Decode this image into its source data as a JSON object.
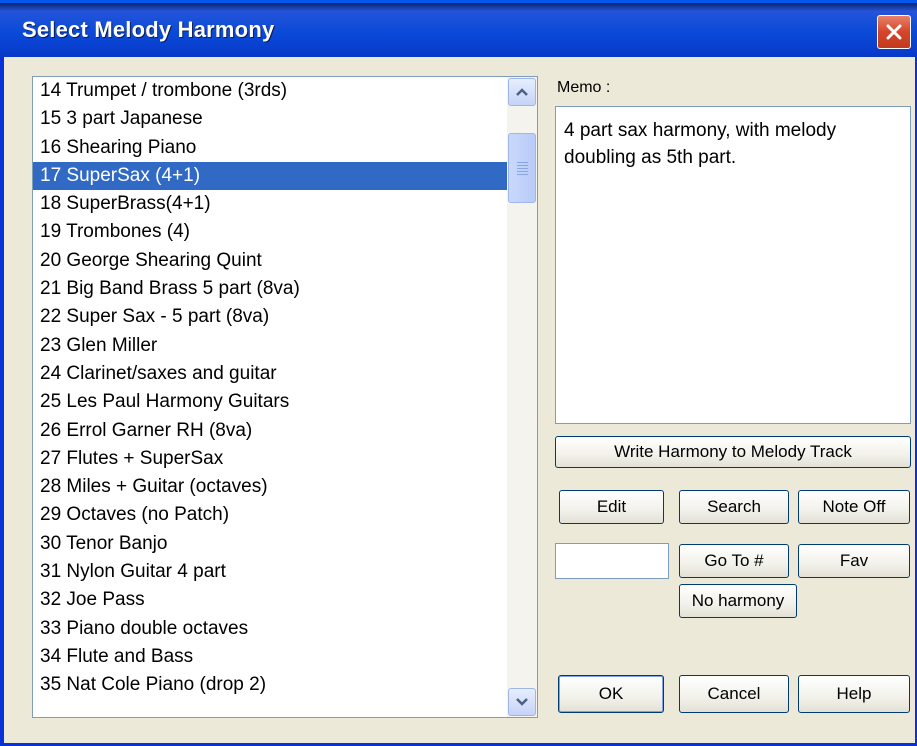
{
  "window": {
    "title": "Select Melody Harmony"
  },
  "list": {
    "items": [
      "14 Trumpet / trombone (3rds)",
      "15 3 part Japanese",
      "16 Shearing Piano",
      "17 SuperSax (4+1)",
      "18 SuperBrass(4+1)",
      "19 Trombones (4)",
      "20 George Shearing Quint",
      "21 Big Band Brass 5 part (8va)",
      "22 Super Sax - 5 part (8va)",
      "23 Glen Miller",
      "24 Clarinet/saxes and guitar",
      "25 Les Paul Harmony Guitars",
      "26 Errol Garner RH (8va)",
      "27 Flutes + SuperSax",
      "28 Miles + Guitar (octaves)",
      "29 Octaves (no Patch)",
      "30 Tenor Banjo",
      "31 Nylon Guitar 4 part",
      "32 Joe Pass",
      "33 Piano double octaves",
      "34 Flute and Bass",
      "35 Nat Cole Piano (drop 2)"
    ],
    "selected_index": 3
  },
  "memo": {
    "label": "Memo :",
    "text": "4 part sax harmony, with melody doubling as 5th part."
  },
  "buttons": {
    "write_harmony": "Write Harmony to Melody Track",
    "edit": "Edit",
    "search": "Search",
    "note_off": "Note Off",
    "go_to": "Go To #",
    "fav": "Fav",
    "no_harmony": "No harmony",
    "ok": "OK",
    "cancel": "Cancel",
    "help": "Help"
  },
  "goto_input": {
    "value": ""
  },
  "colors": {
    "titlebar": "#0a4ad8",
    "selection": "#316ac5",
    "close": "#d5452a",
    "dialog_bg": "#ece9d8"
  }
}
